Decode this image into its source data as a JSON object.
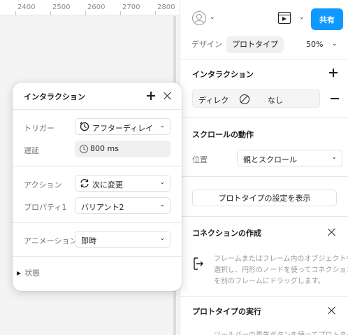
{
  "ruler": {
    "labels": [
      "2400",
      "2500",
      "2600",
      "2700",
      "2800"
    ]
  },
  "toolbar": {
    "share_label": "共有",
    "avatar_icon": "user-avatar-icon",
    "present_icon": "play-frame-icon"
  },
  "tabs": {
    "design": "デザイン",
    "prototype": "プロトタイプ",
    "zoom": "50%"
  },
  "interactions_section": {
    "title": "インタラクション",
    "row": {
      "trigger": "ディレク",
      "action": "なし"
    }
  },
  "scroll_section": {
    "title": "スクロールの動作",
    "position_label": "位置",
    "position_value": "親とスクロール"
  },
  "settings_button": "プロトタイプの設定を表示",
  "connection_section": {
    "title": "コネクションの作成",
    "description": [
      "フレームまたはフレーム内のオブジェクトを",
      "選択し、円形のノードを使ってコネクション",
      "を別のフレームにドラッグします。"
    ]
  },
  "run_section": {
    "title": "プロトタイプの実行",
    "description": "ツールバーの再生ボタンを使ってプロトタイ"
  },
  "popup": {
    "title": "インタラクション",
    "trigger_label": "トリガー",
    "trigger_value": "アフターディレイ",
    "delay_label": "遅延",
    "delay_value": "800 ms",
    "action_label": "アクション",
    "action_value": "次に変更",
    "property_label": "プロパティ1",
    "property_value": "バリアント2",
    "animation_label": "アニメーション",
    "animation_value": "即時",
    "state_label": "状態"
  },
  "colors": {
    "accent": "#0d99ff",
    "canvas": "#f4f4f4",
    "text": "#1e1e1e",
    "muted": "#757575"
  }
}
